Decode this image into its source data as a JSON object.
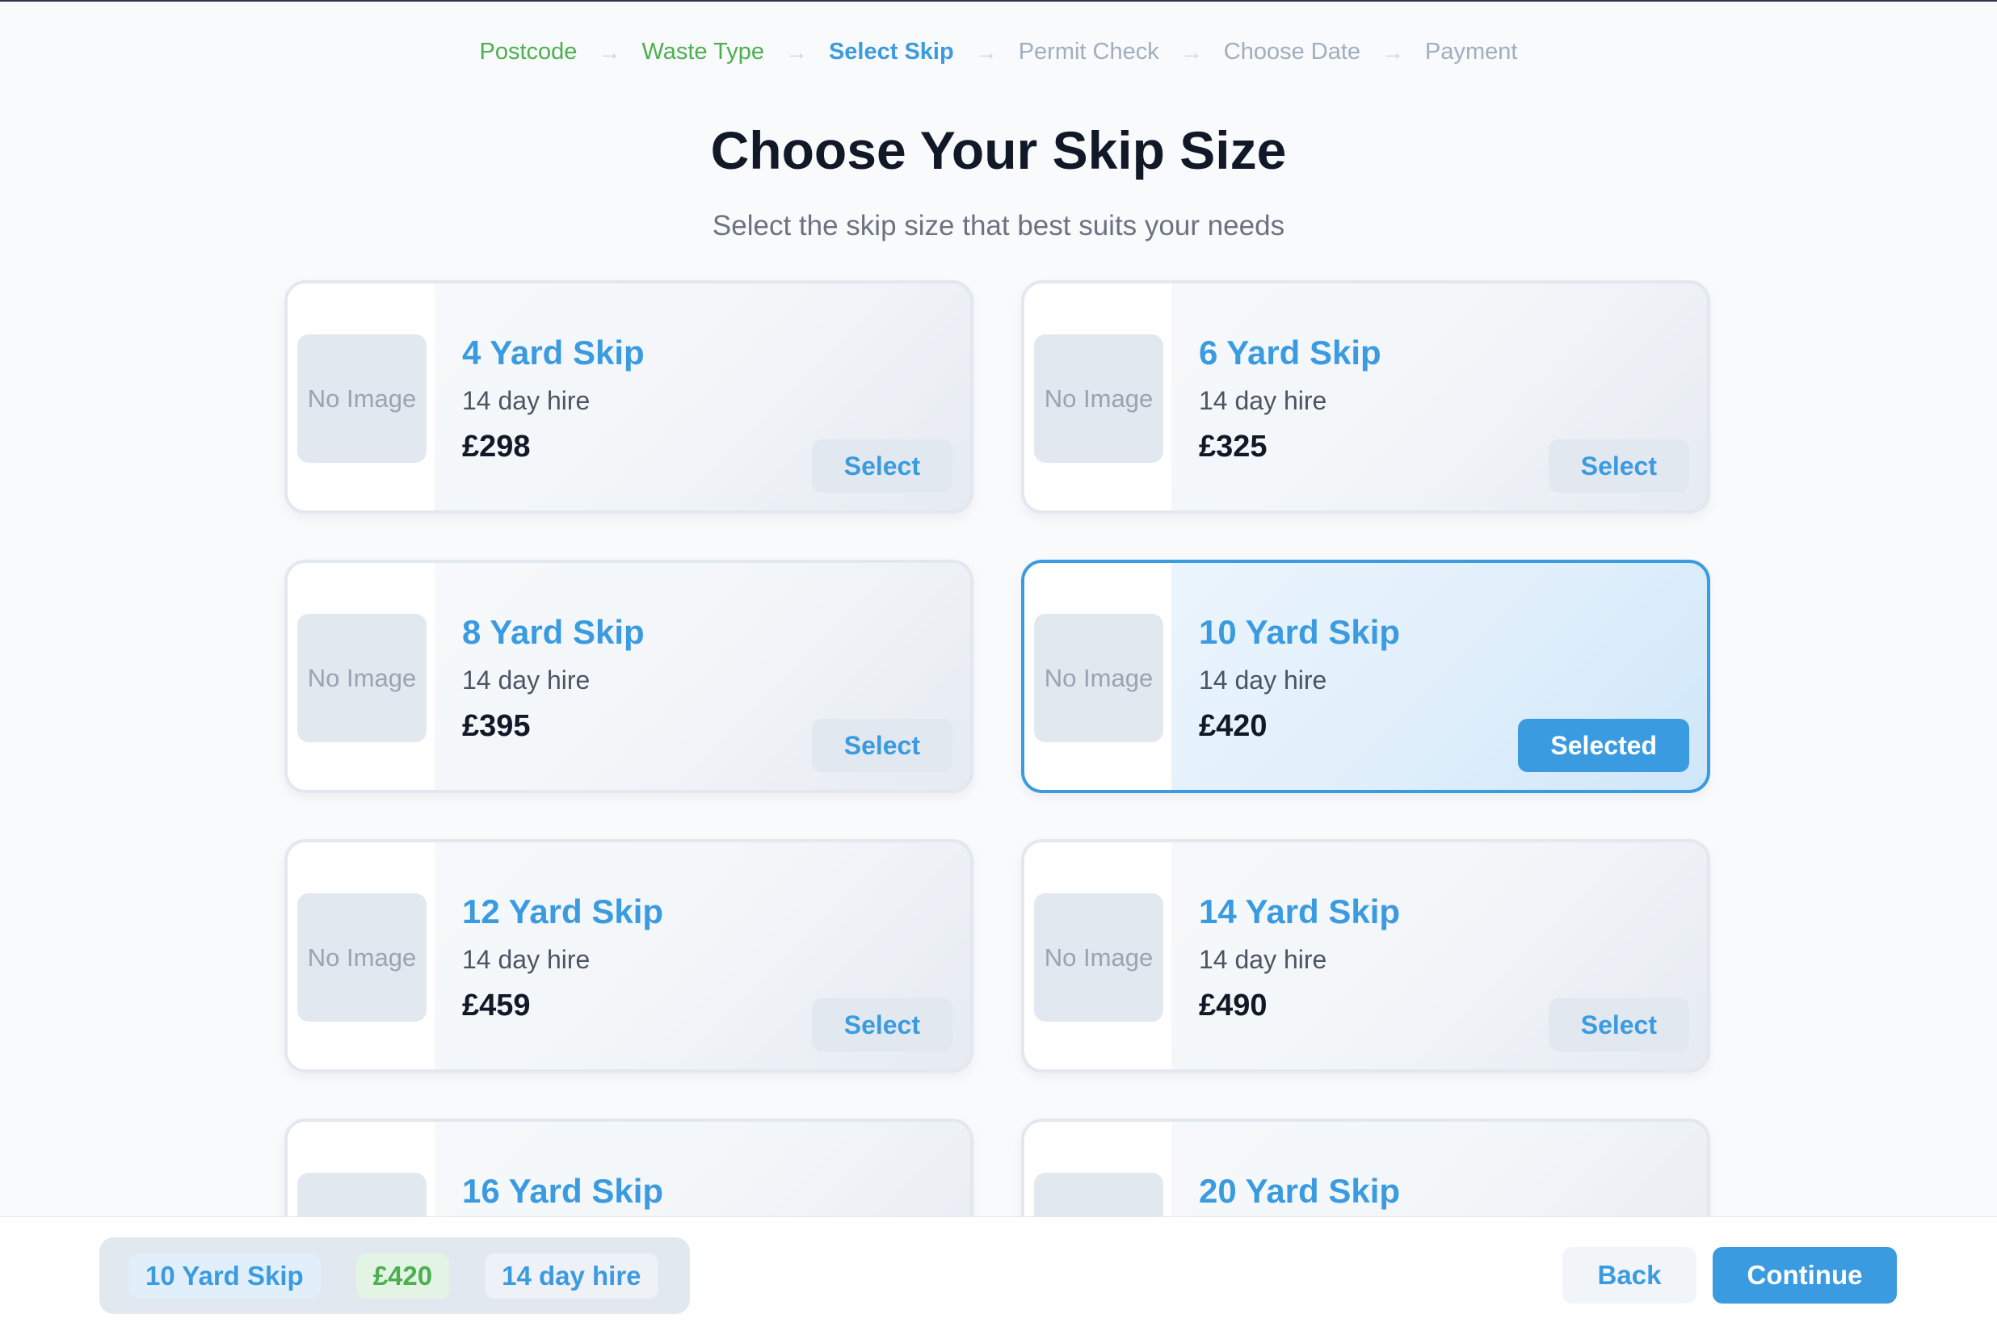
{
  "stepper": {
    "steps": [
      {
        "label": "Postcode",
        "state": "done"
      },
      {
        "label": "Waste Type",
        "state": "done"
      },
      {
        "label": "Select Skip",
        "state": "active"
      },
      {
        "label": "Permit Check",
        "state": "todo"
      },
      {
        "label": "Choose Date",
        "state": "todo"
      },
      {
        "label": "Payment",
        "state": "todo"
      }
    ],
    "arrow": "→"
  },
  "header": {
    "title": "Choose Your Skip Size",
    "subtitle": "Select the skip size that best suits your needs"
  },
  "skips": [
    {
      "name": "4 Yard Skip",
      "hire": "14 day hire",
      "price": "£298",
      "image_text": "No Image",
      "button": "Select",
      "selected": false
    },
    {
      "name": "6 Yard Skip",
      "hire": "14 day hire",
      "price": "£325",
      "image_text": "No Image",
      "button": "Select",
      "selected": false
    },
    {
      "name": "8 Yard Skip",
      "hire": "14 day hire",
      "price": "£395",
      "image_text": "No Image",
      "button": "Select",
      "selected": false
    },
    {
      "name": "10 Yard Skip",
      "hire": "14 day hire",
      "price": "£420",
      "image_text": "No Image",
      "button": "Selected",
      "selected": true
    },
    {
      "name": "12 Yard Skip",
      "hire": "14 day hire",
      "price": "£459",
      "image_text": "No Image",
      "button": "Select",
      "selected": false
    },
    {
      "name": "14 Yard Skip",
      "hire": "14 day hire",
      "price": "£490",
      "image_text": "No Image",
      "button": "Select",
      "selected": false
    },
    {
      "name": "16 Yard Skip",
      "hire": "",
      "price": "",
      "image_text": "",
      "button": "",
      "selected": false
    },
    {
      "name": "20 Yard Skip",
      "hire": "",
      "price": "",
      "image_text": "",
      "button": "",
      "selected": false
    }
  ],
  "summary": {
    "size": "10 Yard Skip",
    "price": "£420",
    "hire": "14 day hire"
  },
  "actions": {
    "back_label": "Back",
    "continue_label": "Continue"
  },
  "colors": {
    "accent": "#3b9be0",
    "done": "#4caf50",
    "todo": "#a0aec0"
  }
}
